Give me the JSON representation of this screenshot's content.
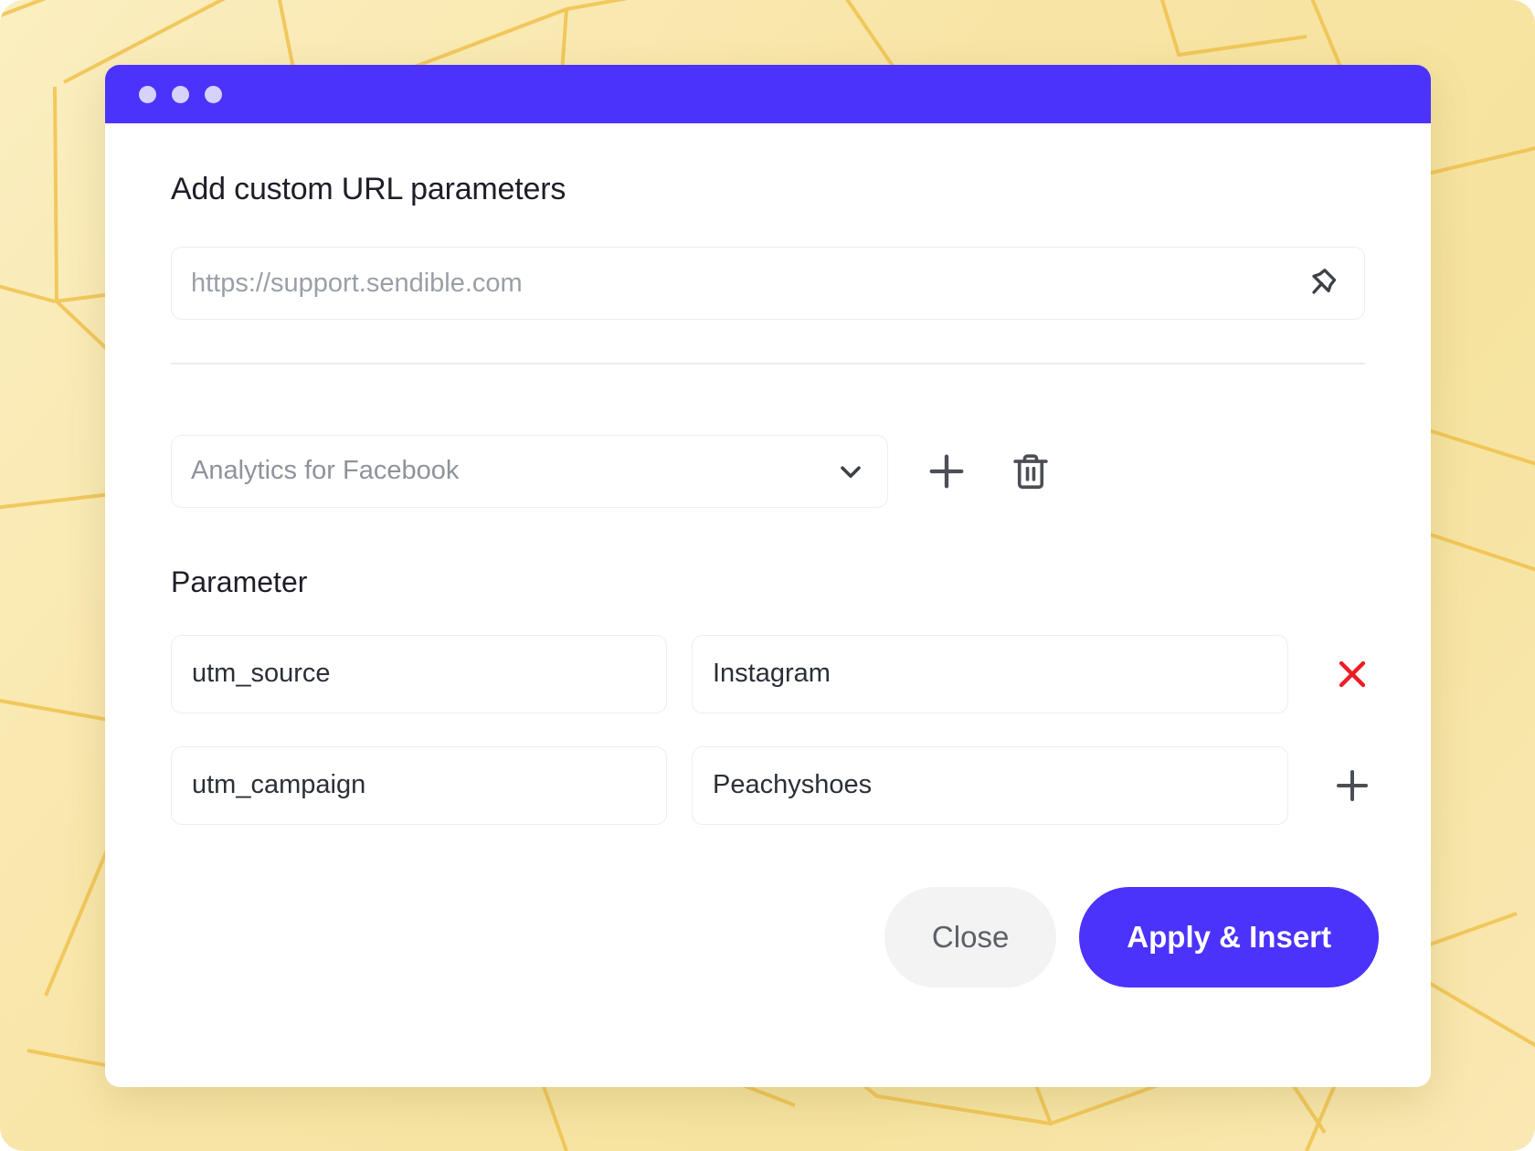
{
  "window": {
    "titlebar": {
      "accent_color": "#4c33fb",
      "dot_color": "#d7d2fb",
      "dots": [
        "traffic-dot-1",
        "traffic-dot-2",
        "traffic-dot-3"
      ]
    }
  },
  "dialog": {
    "title": "Add custom URL parameters"
  },
  "url_section": {
    "input_value": "",
    "placeholder": "https://support.sendible.com",
    "pin_icon": "pin-off-icon"
  },
  "profile_section": {
    "select_value": "Analytics for Facebook",
    "chevron_icon": "chevron-down-icon",
    "add_icon": "plus-icon",
    "delete_icon": "trash-icon"
  },
  "parameters_section": {
    "heading": "Parameter",
    "rows": [
      {
        "key": "utm_source",
        "value": "Instagram",
        "action_icon": "close-x-icon",
        "action_color": "#ec1c24"
      },
      {
        "key": "utm_campaign",
        "value": "Peachyshoes",
        "action_icon": "plus-icon",
        "action_color": "#4b4f55"
      }
    ]
  },
  "footer": {
    "close_label": "Close",
    "apply_label": "Apply & Insert",
    "close_bg": "#f3f3f4",
    "apply_bg": "#4c33fb"
  },
  "backdrop": {
    "base_color": "#f8e5a6",
    "line_color": "#f0c24e"
  }
}
